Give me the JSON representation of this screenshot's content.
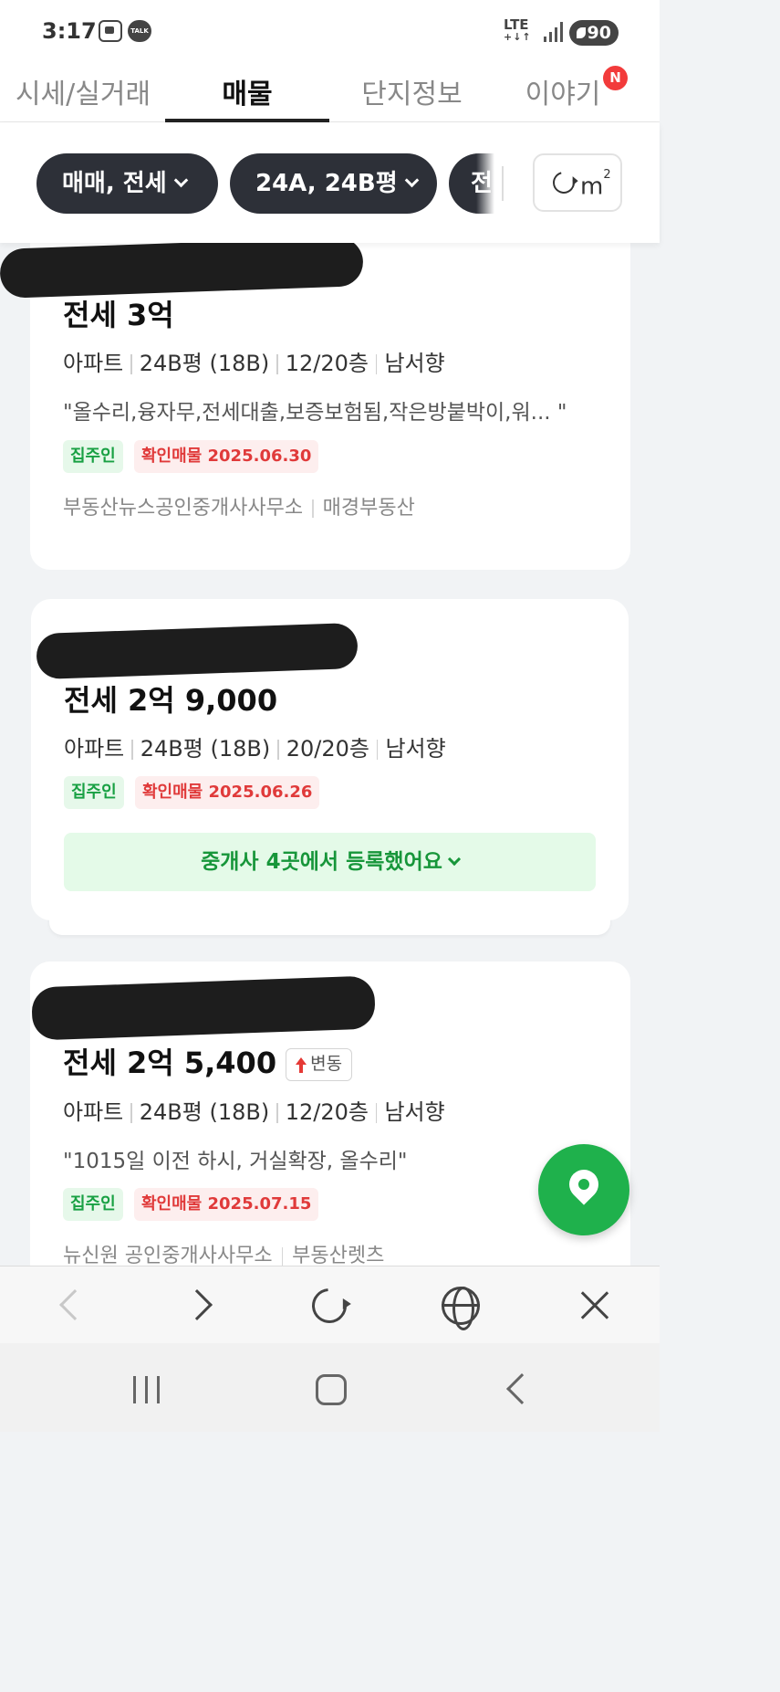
{
  "status_bar": {
    "time": "3:17",
    "talk_label": "TALK",
    "network": "LTE",
    "network_sub": "+↓↑",
    "battery": "90",
    "icons": [
      "screenshot-icon",
      "kakaotalk-icon",
      "lte-icon",
      "signal-icon",
      "battery-icon"
    ]
  },
  "tabs": [
    {
      "label": "시세/실거래",
      "active": false
    },
    {
      "label": "매물",
      "active": true
    },
    {
      "label": "단지정보",
      "active": false
    },
    {
      "label": "이야기",
      "active": false,
      "badge": "N"
    }
  ],
  "filters": {
    "chips": [
      "매매, 전세",
      "24A, 24B평",
      "전"
    ],
    "unit_label": "m",
    "unit_sup": "2"
  },
  "listings": [
    {
      "price": "전세 3억",
      "specs": [
        "아파트",
        "24B평 (18B)",
        "12/20층",
        "남서향"
      ],
      "description": "\"올수리,융자무,전세대출,보증보험됨,작은방붙박이,워... \"",
      "tags": [
        "집주인",
        "확인매물 2025.06.30"
      ],
      "agencies": [
        "부동산뉴스공인중개사사무소",
        "매경부동산"
      ]
    },
    {
      "price": "전세 2억 9,000",
      "specs": [
        "아파트",
        "24B평 (18B)",
        "20/20층",
        "남서향"
      ],
      "tags": [
        "집주인",
        "확인매물 2025.06.26"
      ],
      "agency_button": "중개사 4곳에서 등록했어요"
    },
    {
      "price": "전세 2억 5,400",
      "change_badge": "변동",
      "specs": [
        "아파트",
        "24B평 (18B)",
        "12/20층",
        "남서향"
      ],
      "description": "\"1015일 이전 하시, 거실확장, 올수리\"",
      "tags": [
        "집주인",
        "확인매물 2025.07.15"
      ],
      "agencies": [
        "뉴신원 공인중개사사무소",
        "부동산렛츠"
      ]
    }
  ],
  "colors": {
    "accent_green": "#1fb14c",
    "chip_dark": "#2d3038",
    "owner_tag": "#18a043",
    "verified_tag": "#e03a3a",
    "badge_red": "#f23b3b"
  }
}
